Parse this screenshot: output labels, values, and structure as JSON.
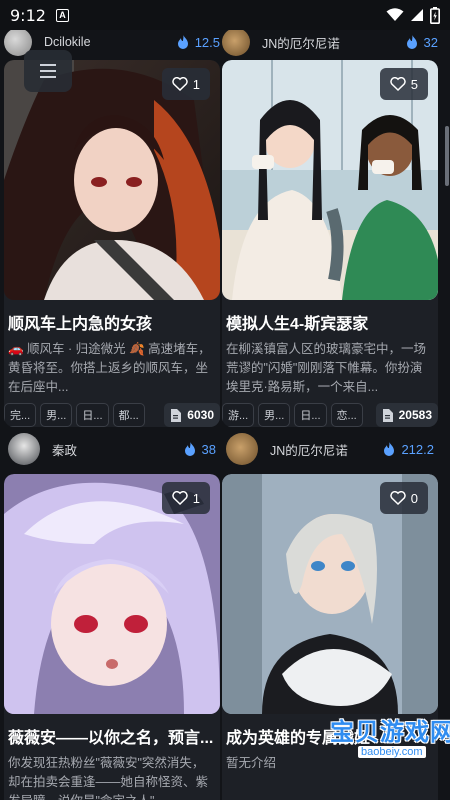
{
  "status": {
    "time": "9:12",
    "notif_icon": "A"
  },
  "top_row": {
    "left": {
      "author": "Dcilokile",
      "heat": "12.5"
    },
    "right": {
      "author": "JN的厄尔尼诺",
      "heat": "32"
    }
  },
  "cards": [
    {
      "likes": "1",
      "title": "顺风车上内急的女孩",
      "desc": "🚗 顺风车 · 归途微光 🍂 高速堵车，黄昏将至。你搭上返乡的顺风车，坐在后座中...",
      "tags": [
        "完...",
        "男...",
        "日...",
        "都..."
      ],
      "count": "6030",
      "author": "秦政",
      "heat": "38"
    },
    {
      "likes": "5",
      "title": "模拟人生4-斯宾瑟家",
      "desc": "在柳溪镇富人区的玻璃豪宅中，一场荒谬的\"闪婚\"刚刚落下帷幕。你扮演埃里克·路易斯，一个来自...",
      "tags": [
        "游...",
        "男...",
        "日...",
        "恋..."
      ],
      "count": "20583",
      "author": "JN的厄尔尼诺",
      "heat": "212.2"
    },
    {
      "likes": "1",
      "title": "薇薇安——以你之名，预言...",
      "desc": "你发现狂热粉丝\"薇薇安\"突然消失，却在拍卖会重逢——她自称怪资、紫发异瞳，说你是\"命定之人\"..."
    },
    {
      "likes": "0",
      "title": "成为英雄的专属战姬",
      "desc": "暂无介绍"
    }
  ],
  "watermark": {
    "text": "宝贝游戏网",
    "url": "baobeiy.com"
  },
  "colors": {
    "accent": "#5aa1ff",
    "background": "#121418",
    "card": "#1d2026"
  }
}
